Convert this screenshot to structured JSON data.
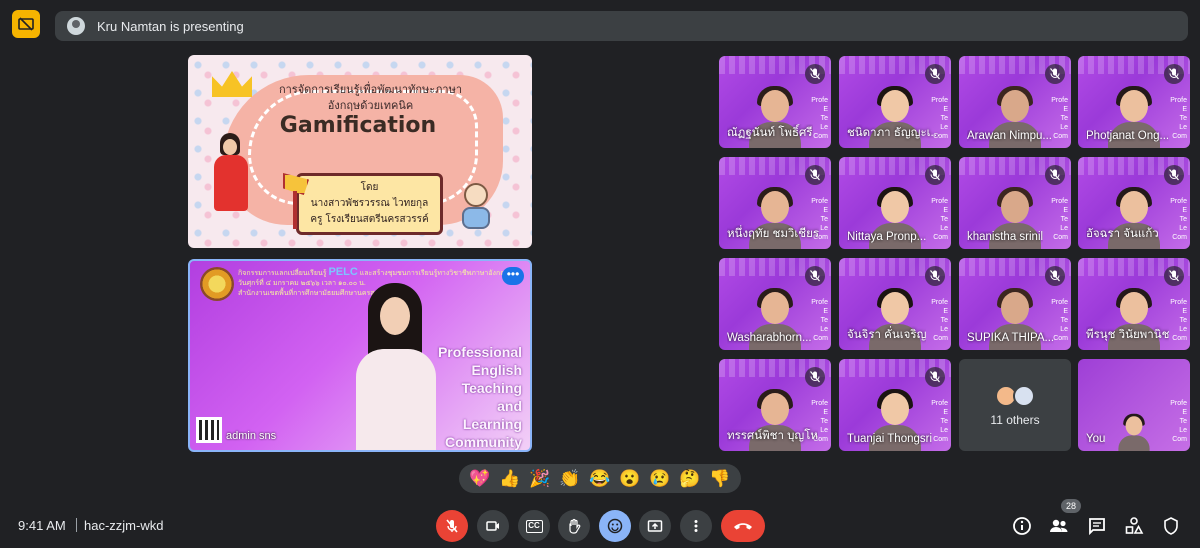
{
  "top_bar": {
    "presenting_text": "Kru Namtan is presenting"
  },
  "slides": {
    "top": {
      "title_line1": "การจัดการเรียนรู้เพื่อพัฒนาทักษะภาษา",
      "title_line2": "อังกฤษด้วยเทคนิค",
      "title_main": "Gamification",
      "by_label": "โดย",
      "author": "นางสาวพัชรวรรณ  ไวทยกุล",
      "position": "ครู โรงเรียนสตรีนครสวรรค์"
    },
    "bottom": {
      "header_line1": "กิจกรรมการแลกเปลี่ยนเรียนรู้",
      "pelc": "PELC",
      "header_line1b": "และสร้างชุมชนการเรียนรู้ทางวิชาชีพภาษาอังกฤษ",
      "header_line2": "วันศุกร์ที่ ๔ มกราคม ๒๕๖๖ เวลา ๑๐.๐๐ น.",
      "header_line3": "สำนักงานเขตพื้นที่การศึกษามัธยมศึกษานครสวรรค์",
      "slogan": [
        "Professional",
        "English",
        "Teaching",
        "and",
        "Learning",
        "Community"
      ],
      "presenter_name": "admin sns",
      "more_label": "•••"
    }
  },
  "participants": [
    {
      "name": "ณัฏฐนันท์ โพธิ์ศรี"
    },
    {
      "name": "ชนิดาภา ธัญญะเ..."
    },
    {
      "name": "Arawan Nimpu..."
    },
    {
      "name": "Photjanat Ong..."
    },
    {
      "name": "หนึ่งฤทัย ชมวิเชียร"
    },
    {
      "name": "Nittaya Pronp..."
    },
    {
      "name": "khanistha srinil"
    },
    {
      "name": "อัจฉรา จันแก้ว"
    },
    {
      "name": "Washarabhorn..."
    },
    {
      "name": "จันจิรา คั่นเจริญ"
    },
    {
      "name": "SUPIKA THIPA..."
    },
    {
      "name": "พีรนุช วินัยพานิช"
    },
    {
      "name": "ทรรศน์พิชา บุญโห"
    },
    {
      "name": "Tuanjai Thongsri"
    },
    {
      "name": "11 others"
    },
    {
      "name": "You"
    }
  ],
  "tile_side_text": [
    "Profe",
    "E",
    "Te",
    "",
    "Le",
    "Com"
  ],
  "reactions": [
    "💖",
    "👍",
    "🎉",
    "👏",
    "😂",
    "😮",
    "😢",
    "🤔",
    "👎"
  ],
  "bottom_bar": {
    "time": "9:41 AM",
    "meeting_code": "hac-zzjm-wkd",
    "cc_label": "CC",
    "participant_count": "28"
  },
  "colors": {
    "background": "#202124",
    "surface": "#3c4043",
    "danger": "#ea4335",
    "accent": "#8ab4f8",
    "warning": "#f6b400"
  }
}
